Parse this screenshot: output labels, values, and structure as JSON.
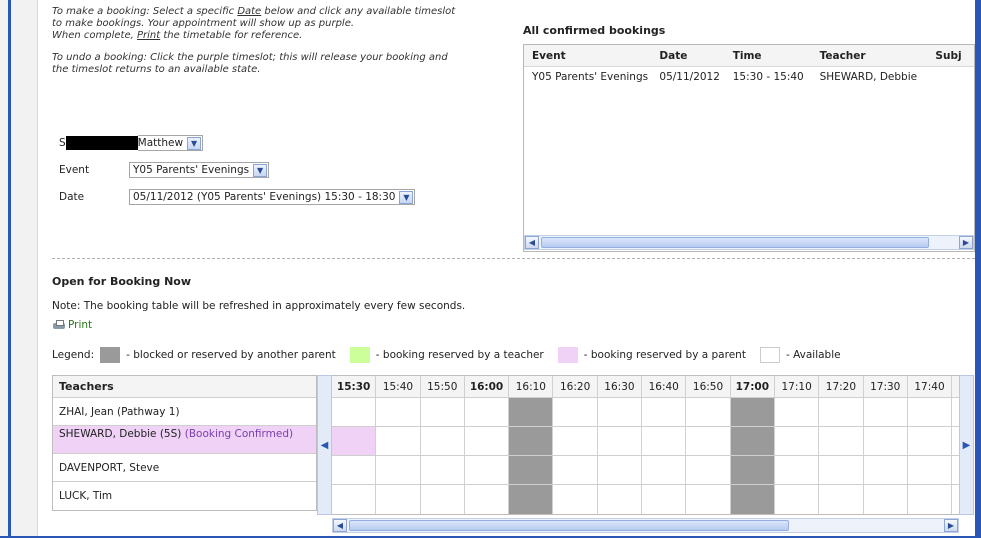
{
  "instructions": {
    "line1_a": "To make a booking: Select a specific ",
    "line1_link": "Date",
    "line1_b": " below and click any available timeslot to make bookings. Your appointment will show up as purple.",
    "line2_a": "When complete, ",
    "line2_link": "Print",
    "line2_b": " the timetable for reference.",
    "line3": "To undo a booking: Click the purple timeslot; this will release your booking and the timeslot returns to an available state."
  },
  "form": {
    "student_label_prefix": "S",
    "student_value": "Matthew",
    "event_label": "Event",
    "event_value": "Y05 Parents' Evenings",
    "date_label": "Date",
    "date_value": "05/11/2012 (Y05 Parents' Evenings) 15:30 - 18:30"
  },
  "confirmed": {
    "title": "All confirmed bookings",
    "columns": [
      "Event",
      "Date",
      "Time",
      "Teacher",
      "Subj"
    ],
    "rows": [
      [
        "Y05 Parents' Evenings",
        "05/11/2012",
        "15:30 - 15:40",
        "SHEWARD, Debbie",
        ""
      ]
    ]
  },
  "open": {
    "title": "Open for Booking Now",
    "note": "Note: The booking table will be refreshed in approximately every few seconds.",
    "print_label": "Print"
  },
  "legend": {
    "label": "Legend:",
    "blocked": "- blocked or reserved by another parent",
    "teacher": "- booking reserved by a teacher",
    "parent": "- booking reserved by a parent",
    "available": "- Available"
  },
  "colors": {
    "blocked": "#9a9a9a",
    "teacher_reserved": "#ccff99",
    "parent_reserved": "#f0d2f7",
    "available": "#ffffff",
    "accent": "#2a57b5"
  },
  "table": {
    "teachers_header": "Teachers",
    "teachers": [
      {
        "name": "ZHAI, Jean (Pathway 1)",
        "status": ""
      },
      {
        "name": "SHEWARD, Debbie (5S)",
        "status": "(Booking Confirmed)"
      },
      {
        "name": "DAVENPORT, Steve",
        "status": ""
      },
      {
        "name": "LUCK, Tim",
        "status": ""
      }
    ],
    "times": [
      {
        "t": "15:30",
        "bold": true
      },
      {
        "t": "15:40",
        "bold": false
      },
      {
        "t": "15:50",
        "bold": false
      },
      {
        "t": "16:00",
        "bold": true
      },
      {
        "t": "16:10",
        "bold": false
      },
      {
        "t": "16:20",
        "bold": false
      },
      {
        "t": "16:30",
        "bold": false
      },
      {
        "t": "16:40",
        "bold": false
      },
      {
        "t": "16:50",
        "bold": false
      },
      {
        "t": "17:00",
        "bold": true
      },
      {
        "t": "17:10",
        "bold": false
      },
      {
        "t": "17:20",
        "bold": false
      },
      {
        "t": "17:30",
        "bold": false
      },
      {
        "t": "17:40",
        "bold": false
      }
    ],
    "slots": [
      [
        "a",
        "a",
        "a",
        "a",
        "b",
        "a",
        "a",
        "a",
        "a",
        "b",
        "a",
        "a",
        "a",
        "a"
      ],
      [
        "p",
        "a",
        "a",
        "a",
        "b",
        "a",
        "a",
        "a",
        "a",
        "b",
        "a",
        "a",
        "a",
        "a"
      ],
      [
        "a",
        "a",
        "a",
        "a",
        "b",
        "a",
        "a",
        "a",
        "a",
        "b",
        "a",
        "a",
        "a",
        "a"
      ],
      [
        "a",
        "a",
        "a",
        "a",
        "b",
        "a",
        "a",
        "a",
        "a",
        "b",
        "a",
        "a",
        "a",
        "a"
      ]
    ]
  }
}
